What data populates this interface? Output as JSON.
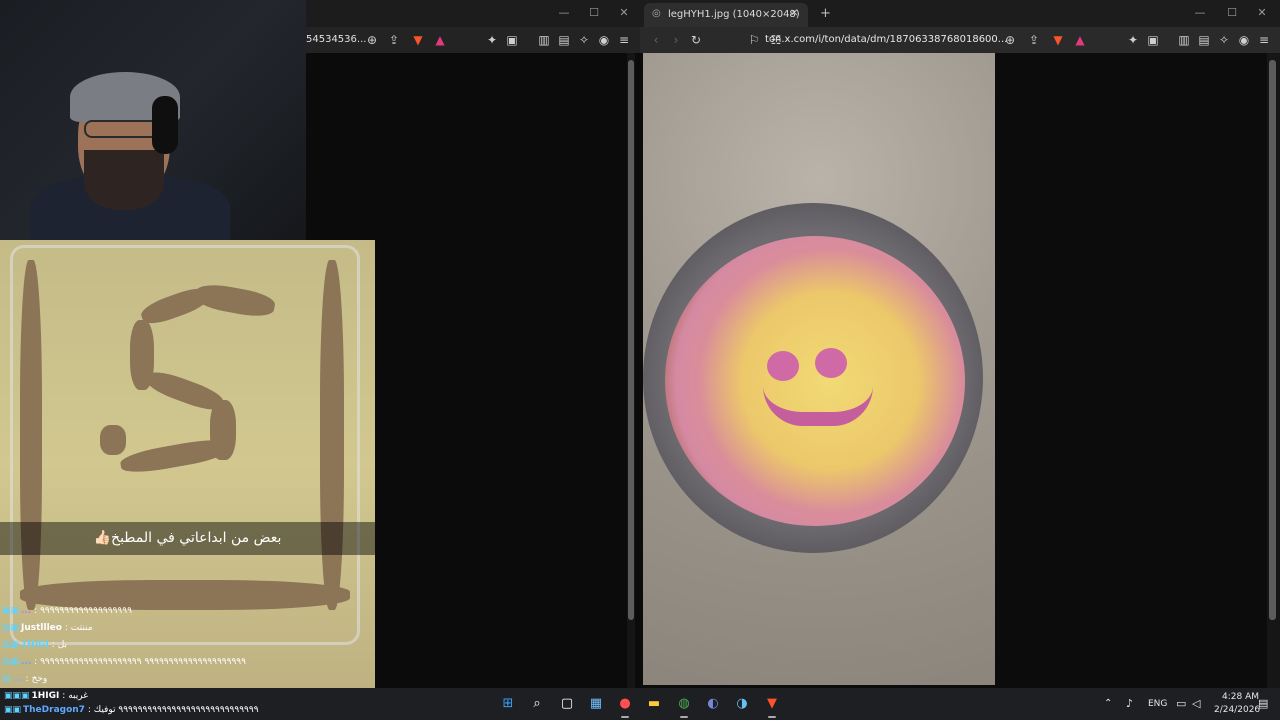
{
  "left_browser": {
    "url_fragment": "54534536...",
    "caption": "بعض من ابداعاتي في المطبخ👍🏻"
  },
  "right_browser": {
    "tab_title": "legHYH1.jpg (1040×2048)",
    "url": "ton.x.com/i/ton/data/dm/18706338768018600...",
    "new_tab": "+"
  },
  "chat": {
    "messages": [
      {
        "user": "...",
        "text": ": ٩٩٩٩٩٩٩٩٩٩٩٩٩٩٩٩٩٩٩",
        "color": "#b07cff"
      },
      {
        "user": "Justllleo",
        "text": ": مننتت",
        "color": "#ffffff"
      },
      {
        "user": "1HIGI",
        "text": ": بل",
        "color": "#5fd3ff"
      },
      {
        "user": "...",
        "text": ": ٩٩٩٩٩٩٩٩٩٩٩٩٩٩٩٩٩٩٩٩٩ ٩٩٩٩٩٩٩٩٩٩٩٩٩٩٩٩٩٩٩٩٩",
        "color": "#5fa8ff"
      },
      {
        "user": "...",
        "text": ": وخخ",
        "color": "#7fb0ff"
      },
      {
        "user": "1HIGI",
        "text": ": غريبه",
        "color": "#ffffff"
      },
      {
        "user": "TheDragon7",
        "text": ": ٩٩٩٩٩٩٩٩٩٩٩٩٩٩٩٩٩٩٩٩٩٩٩٩٩٩٩٩٩ توفيك",
        "color": "#5fa8ff"
      }
    ]
  },
  "taskbar": {
    "lang": "ENG",
    "time": "4:28 AM",
    "date": "2/24/2026",
    "icons": [
      "windows-icon",
      "search-icon",
      "task-view-icon",
      "store-icon",
      "app-icon",
      "file-explorer-icon",
      "chrome-icon",
      "discord-icon",
      "steam-icon",
      "brave-icon"
    ]
  },
  "colors": {
    "accent": "#0a84ff",
    "brave": "#fb542b"
  }
}
